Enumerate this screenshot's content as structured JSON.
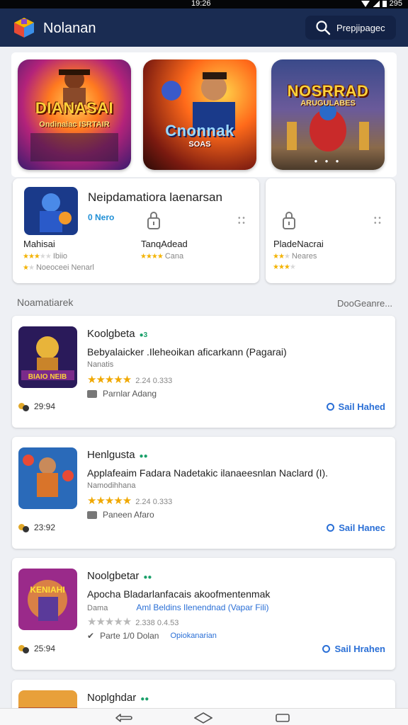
{
  "status": {
    "time": "19:26",
    "battery": "295"
  },
  "app": {
    "title": "Nolanan",
    "search_label": "Prepjipagec"
  },
  "featured": [
    {
      "title": "DIANASAI",
      "subtitle": "Ondinaiac ISRTAIR"
    },
    {
      "title": "Cnonnak",
      "subtitle": "SOAS"
    },
    {
      "title": "NOSRRAD",
      "subtitle": "ARUGULABES"
    }
  ],
  "recommend": {
    "headline": "Neipdamatiora laenarsan",
    "badge": "0 Nero",
    "items": [
      {
        "name": "Mahisai",
        "meta": "Ibiio",
        "meta2": "Noeoceei Nenarl"
      },
      {
        "name": "TanqAdead",
        "meta": "Cana"
      },
      {
        "name": "PladeNacrai",
        "meta": "Neares"
      }
    ]
  },
  "section": {
    "label": "Noamatiarek",
    "link": "DooGeanre..."
  },
  "games": [
    {
      "name": "Koolgbeta",
      "desc": "Bebyalaicker .Ileheoikan aficarkann (Pagarai)",
      "sub": "Nanatis",
      "sub_link": "",
      "rating_meta": "2.24 0.333",
      "tag": "Parnlar Adang",
      "tag_extra": "",
      "players": "29:94",
      "action": "Sail Hahed",
      "stars": "★★★★★"
    },
    {
      "name": "Henlgusta",
      "desc": "Applafeaim Fadara Nadetakic ilanaeesnlan Naclard (I).",
      "sub": "Namodihhana",
      "sub_link": "",
      "rating_meta": "2.24 0.333",
      "tag": "Paneen Afaro",
      "tag_extra": "",
      "players": "23:92",
      "action": "Sail Hanec",
      "stars": "★★★★★"
    },
    {
      "name": "Noolgbetar",
      "desc": "Apocha Bladarlanfacais akoofmentenmak",
      "sub": "Dama",
      "sub_link": "Aml Beldins Ilenendnad (Vapar Fili)",
      "rating_meta": "2.338 0.4.53",
      "tag": "Parte 1/0 Dolan",
      "tag_extra": "Opiokanarian",
      "players": "25:94",
      "action": "Sail Hrahen",
      "stars": "★★★★★"
    },
    {
      "name": "Noplghdar"
    }
  ]
}
